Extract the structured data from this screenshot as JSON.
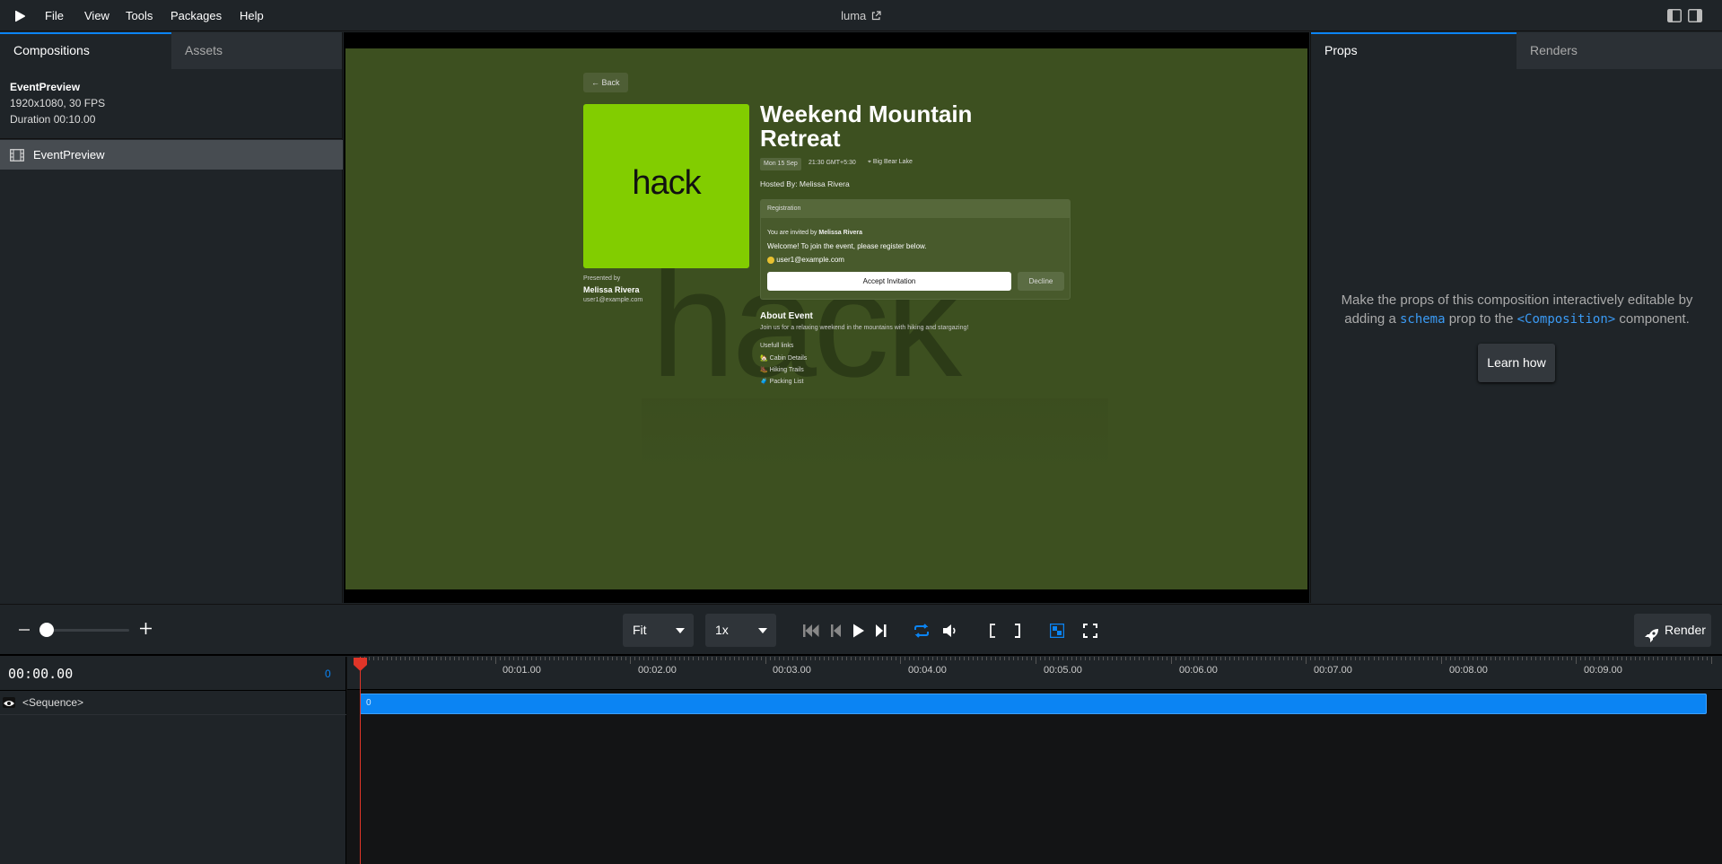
{
  "menu": {
    "items": [
      "File",
      "View",
      "Tools",
      "Packages",
      "Help"
    ],
    "title": "luma"
  },
  "left_panel": {
    "tabs": {
      "compositions": "Compositions",
      "assets": "Assets"
    },
    "composition": {
      "name": "EventPreview",
      "resolution": "1920x1080, 30 FPS",
      "duration": "Duration 00:10.00"
    },
    "list": [
      {
        "label": "EventPreview"
      }
    ]
  },
  "preview": {
    "back_label": "Back",
    "logo_text": "hack",
    "watermark_text": "hack",
    "title_line1": "Weekend Mountain",
    "title_line2": "Retreat",
    "date_badge": "Mon 15 Sep",
    "time": "21:30 GMT+5:30",
    "location": "Big Bear Lake",
    "hosted_by": "Hosted By: Melissa Rivera",
    "presented_by_label": "Presented by",
    "presenter_name": "Melissa Rivera",
    "presenter_email": "user1@example.com",
    "registration": {
      "header": "Registration",
      "invited_prefix": "You are invited by",
      "invited_name": "Melissa Rivera",
      "welcome": "Welcome! To join the event, please register below.",
      "email": "user1@example.com",
      "accept_label": "Accept Invitation",
      "decline_label": "Decline"
    },
    "about_title": "About Event",
    "about_text": "Join us for a relaxing weekend in the mountains with hiking and stargazing!",
    "links_title": "Usefull links",
    "links": [
      "🏡 Cabin Details",
      "🥾 Hiking Trails",
      "🧳 Packing List"
    ]
  },
  "right_panel": {
    "tabs": {
      "props": "Props",
      "renders": "Renders"
    },
    "message_part1": "Make the props of this composition interactively editable by",
    "message_part2a": "adding a",
    "schema_code": "schema",
    "message_part2b": "prop to the",
    "composition_code": "<Composition>",
    "message_part2c": "component.",
    "learn_label": "Learn how"
  },
  "controls": {
    "zoom_value": 0,
    "fit_label": "Fit",
    "speed_label": "1x",
    "render_label": "Render",
    "accent_color": "#0b84f3"
  },
  "timeline": {
    "current_time": "00:00.00",
    "frame": "0",
    "tick_labels": [
      "00:01.00",
      "00:02.00",
      "00:03.00",
      "00:04.00",
      "00:05.00",
      "00:06.00",
      "00:07.00",
      "00:08.00",
      "00:09.00"
    ],
    "track_label": "<Sequence>",
    "sequence_start_label": "0",
    "playhead_color": "#e03528"
  }
}
